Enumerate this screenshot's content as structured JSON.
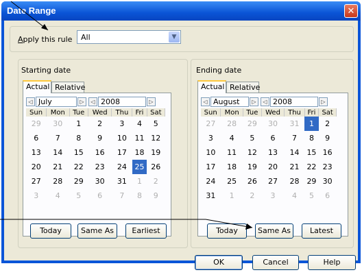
{
  "window": {
    "title": "Date Range",
    "close_glyph": "✕"
  },
  "apply": {
    "label_u": "A",
    "label_rest": "pply this rule",
    "value": "All",
    "arrow": "▼"
  },
  "start": {
    "group_title": "Starting date",
    "tabs": [
      "Actual",
      "Relative"
    ],
    "month": "July",
    "year": "2008",
    "days_header": [
      "Sun",
      "Mon",
      "Tue",
      "Wed",
      "Thu",
      "Fri",
      "Sat"
    ],
    "weeks": [
      [
        "29",
        "30",
        "1",
        "2",
        "3",
        "4",
        "5"
      ],
      [
        "6",
        "7",
        "8",
        "9",
        "10",
        "11",
        "12"
      ],
      [
        "13",
        "14",
        "15",
        "16",
        "17",
        "18",
        "19"
      ],
      [
        "20",
        "21",
        "22",
        "23",
        "24",
        "25",
        "26"
      ],
      [
        "27",
        "28",
        "29",
        "30",
        "31",
        "1",
        "2"
      ],
      [
        "3",
        "4",
        "5",
        "6",
        "7",
        "8",
        "9"
      ]
    ],
    "selected": "25",
    "buttons": [
      "Today",
      "Same As",
      "Earliest"
    ]
  },
  "end": {
    "group_title": "Ending date",
    "tabs": [
      "Actual",
      "Relative"
    ],
    "month": "August",
    "year": "2008",
    "days_header": [
      "Sun",
      "Mon",
      "Tue",
      "Wed",
      "Thu",
      "Fri",
      "Sat"
    ],
    "weeks": [
      [
        "27",
        "28",
        "29",
        "30",
        "31",
        "1",
        "2"
      ],
      [
        "3",
        "4",
        "5",
        "6",
        "7",
        "8",
        "9"
      ],
      [
        "10",
        "11",
        "12",
        "13",
        "14",
        "15",
        "16"
      ],
      [
        "17",
        "18",
        "19",
        "20",
        "21",
        "22",
        "23"
      ],
      [
        "24",
        "25",
        "26",
        "27",
        "28",
        "29",
        "30"
      ],
      [
        "31",
        "1",
        "2",
        "3",
        "4",
        "5",
        "6"
      ]
    ],
    "selected": "1",
    "buttons": [
      "Today",
      "Same As",
      "Latest"
    ]
  },
  "footer": {
    "ok": "OK",
    "cancel": "Cancel",
    "help": "Help"
  },
  "nav": {
    "prev": "◁",
    "next": "▷"
  },
  "colors": {
    "title_bar": "#0a54d6",
    "selected_day": "#316ac5",
    "dialog_bg": "#ece9d8"
  }
}
